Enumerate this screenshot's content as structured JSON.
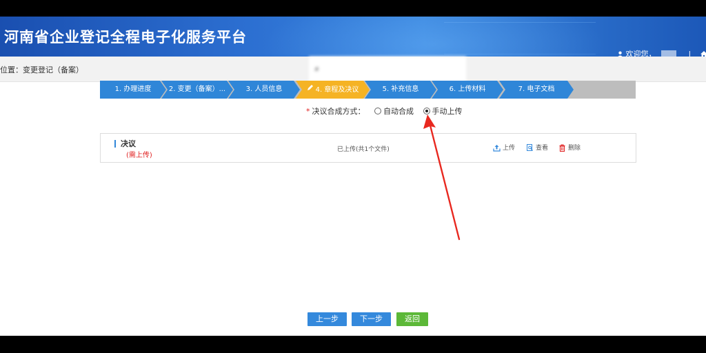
{
  "header": {
    "title": "河南省企业登记全程电子化服务平台",
    "welcome": "欢迎您，",
    "separator": "|",
    "home_label": "首"
  },
  "breadcrumb": {
    "text": "位置：变更登记（备案）"
  },
  "steps": [
    {
      "label": "1. 办理进度",
      "active": false
    },
    {
      "label": "2. 变更（备案）...",
      "active": false
    },
    {
      "label": "3. 人员信息",
      "active": false
    },
    {
      "label": "4. 章程及决议",
      "active": true
    },
    {
      "label": "5. 补充信息",
      "active": false
    },
    {
      "label": "6. 上传材料",
      "active": false
    },
    {
      "label": "7. 电子文档",
      "active": false
    }
  ],
  "decision": {
    "required_mark": "*",
    "label": "决议合成方式：",
    "options": [
      {
        "label": "自动合成",
        "checked": false
      },
      {
        "label": "手动上传",
        "checked": true
      }
    ]
  },
  "document": {
    "title": "决议",
    "required_note": "(需上传)",
    "status": "已上传(共1个文件)",
    "actions": {
      "upload": "上传",
      "view": "查看",
      "delete": "删除"
    }
  },
  "buttons": {
    "prev": "上一步",
    "next": "下一步",
    "back": "返回"
  },
  "colors": {
    "step_blue": "#2f86d8",
    "step_active": "#f5b324",
    "required_red": "#e02020",
    "annotation_arrow": "#e8281f",
    "back_button": "#5cb838"
  }
}
